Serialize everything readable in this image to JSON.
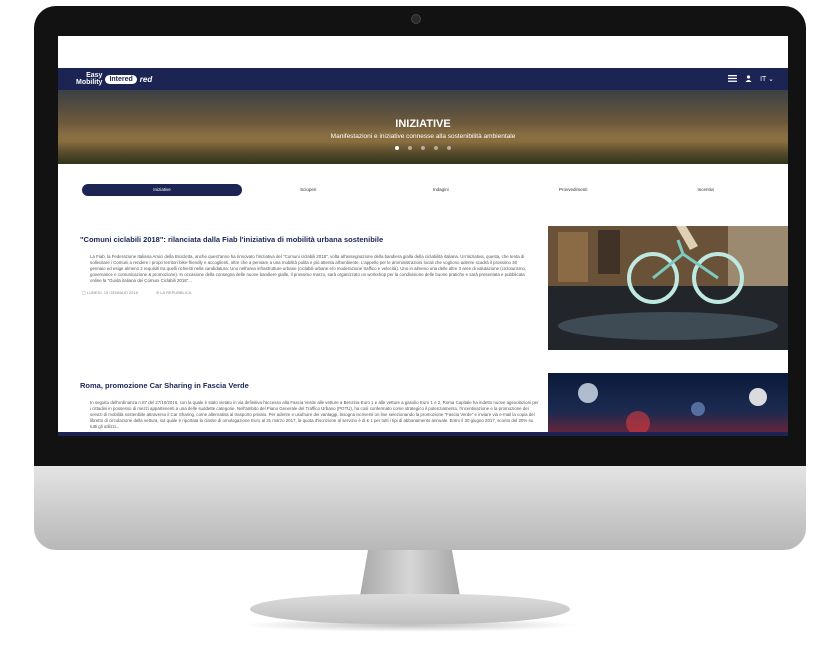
{
  "navbar": {
    "logo_line1": "Easy",
    "logo_line2": "Mobility",
    "logo_badge": "Intered",
    "logo_suffix": "red",
    "lang": "IT",
    "icons": [
      "menu-icon",
      "user-icon",
      "chevron-down-icon"
    ]
  },
  "hero": {
    "title": "INIZIATIVE",
    "subtitle": "Manifestazioni e iniziative connesse alla sostenibilità ambientale",
    "slides": 5,
    "active_slide": 0
  },
  "tabs": [
    "Iniziative",
    "Scioperi",
    "Indagini",
    "Provvedimenti",
    "Incentivi"
  ],
  "active_tab": 0,
  "articles": [
    {
      "title": "\"Comuni ciclabili 2018\": rilanciata dalla Fiab l'iniziativa di mobilità urbana sostenibile",
      "body": "La Fiab, la Federazione Italiana Amici della Bicicletta, anche quest'anno ha rinnovato l'iniziativa del \"Comuni ciclabili 2018\", volta all'assegnazione della bandiera gialla della ciclabilità italiana. Un'iniziativa, questa, che tenta di sollecitare i Comuni a rendere i propri territori bike-friendly e accoglienti, oltre che a pensare a una mobilità pulita e più attenta all'ambiente. L'appello per le amministrazioni locali che vogliono aderire scadrà il prossimo 30 gennaio ed esige almeno 2 requisiti tra quelli richiesti nella candidatura: Uno nell'area infrastrutture urbane (ciclabili urbane e/o moderazione traffico e velocità). Uno in almeno una delle altre 3 aree di valutazione (cicloturismo, governance e comunicazione & promozione). In occasione della consegna delle nuove bandiere gialle, il prossimo marzo, sarà organizzato un workshop per la condivisione delle buone pratiche e sarà presentata e pubblicata online la \"Guida italiana dei Comuni Ciclabili 2018\"...",
      "date": "LUNEDI, 15 GENNAIO 2018",
      "source": "LA REPUBBLICA"
    },
    {
      "title": "Roma, promozione Car Sharing in Fascia Verde",
      "body": "In seguito dell'ordinanza n.87 del 27/10/2016, con la quale è stato vietato in via definitiva l'accesso alla Fascia Verde alle vetture a Benzina Euro 1 e alle vetture a gasolio Euro 1 e 2, Roma Capitale ha indetto nuove agevolazioni per i cittadini in possesso di mezzi appartenenti a una delle suddette categorie. Nell'ambito del Piano Generale del Traffico Urbano (PGTU), ha così confermato come strategico il potenziamento, l'incentivazione e la promozione dei servizi di mobilità sostenibile attraverso il Car Sharing, come alternativa al trasporto privato. Per aderire e usufruire dei vantaggi, bisogna iscriversi on line selezionando la promozione \"Fascia Verde\" e inviare via e-mail la copia del libretto di circolazione della vettura, sul quale è riportata la classe di omologazione Euro al 31 marzo 2017, la quota d'iscrizione al servizio è di € 1 per tutti i tipi di abbonamento annuale. Entro il 30 giugno 2017, sconto del 20% su tutti gli utilizzi..."
    }
  ]
}
